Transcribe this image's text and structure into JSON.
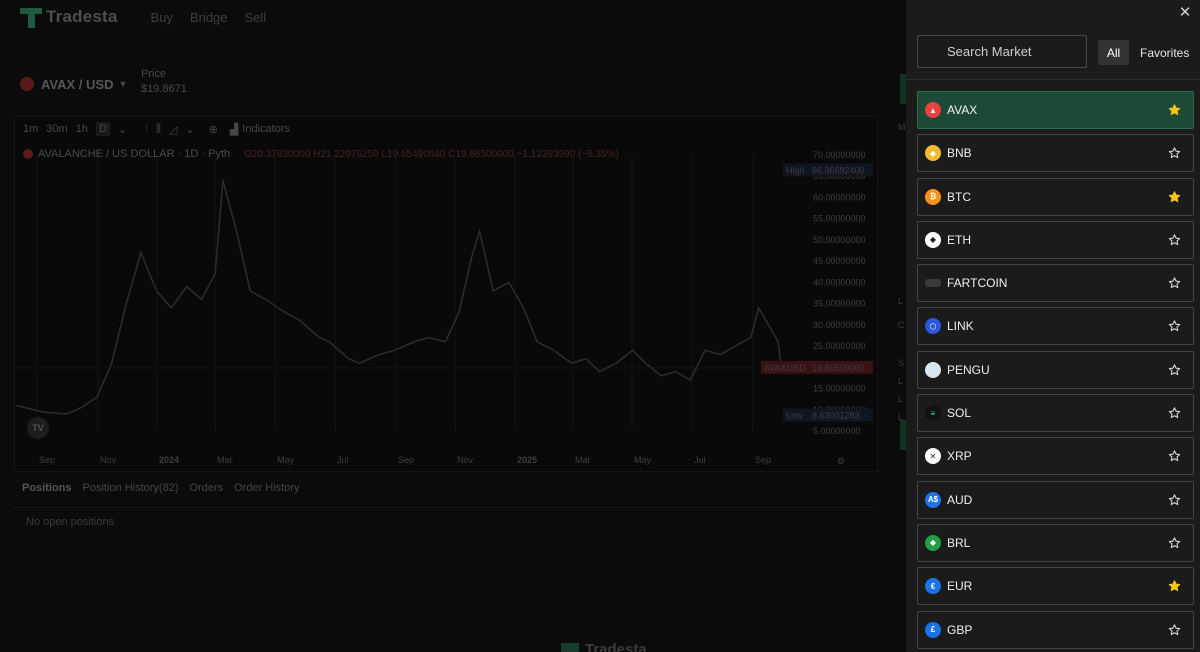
{
  "brand": {
    "name": "Tradesta"
  },
  "nav": {
    "items": [
      "Buy",
      "Bridge",
      "Sell"
    ]
  },
  "pair": {
    "label": "AVAX / USD",
    "price_label": "Price",
    "price_value": "$19.8671"
  },
  "toolbar": {
    "timeframes": [
      "1m",
      "30m",
      "1h"
    ],
    "selected_timeframe": "D",
    "indicators_label": "Indicators"
  },
  "chart": {
    "legend_title": "AVALANCHE / US DOLLAR · 1D · Pyth",
    "legend_ohlc": "O20.37630000 H21.22976250 L19.65490640 C19.86500000 −1.12393990 (−5.35%)",
    "high_label": "High",
    "high_value": "66.36692400",
    "low_label": "Low",
    "low_value": "8.63001283",
    "current_symbol": "AVAXUSD",
    "current_value": "19.86500000",
    "tv_badge": "TV"
  },
  "chart_data": {
    "type": "line",
    "title": "AVALANCHE / US DOLLAR · 1D · Pyth",
    "xlabel": "",
    "ylabel": "",
    "x_ticks": [
      "Sep",
      "Nov",
      "2024",
      "Mar",
      "May",
      "Jul",
      "Sep",
      "Nov",
      "2025",
      "Mar",
      "May",
      "Jul",
      "Sep"
    ],
    "y_ticks": [
      5,
      10,
      15,
      20,
      25,
      30,
      35,
      40,
      45,
      50,
      55,
      60,
      65,
      70
    ],
    "y_tick_labels": [
      "5.00000000",
      "10.00000000",
      "15.00000000",
      "20.00000000",
      "25.00000000",
      "30.00000000",
      "35.00000000",
      "40.00000000",
      "45.00000000",
      "50.00000000",
      "55.00000000",
      "60.00000000",
      "65.00000000",
      "70.00000000"
    ],
    "ylim": [
      5,
      70
    ],
    "grid": true,
    "series": [
      {
        "x": [
          "2023-08-20",
          "2023-09-15",
          "2023-10-10",
          "2023-10-25",
          "2023-11-10",
          "2023-11-25",
          "2023-12-10",
          "2023-12-25",
          "2024-01-10",
          "2024-01-25",
          "2024-02-10",
          "2024-02-25",
          "2024-03-10",
          "2024-03-18",
          "2024-04-01",
          "2024-04-15",
          "2024-05-01",
          "2024-05-20",
          "2024-06-05",
          "2024-06-25",
          "2024-07-05",
          "2024-07-25",
          "2024-08-05",
          "2024-08-25",
          "2024-09-10",
          "2024-09-30",
          "2024-10-15",
          "2024-11-01",
          "2024-11-15",
          "2024-11-28",
          "2024-12-06",
          "2024-12-20",
          "2025-01-05",
          "2025-01-20",
          "2025-02-03",
          "2025-02-20",
          "2025-03-10",
          "2025-03-25",
          "2025-04-08",
          "2025-04-25",
          "2025-05-12",
          "2025-05-25",
          "2025-06-10",
          "2025-06-25",
          "2025-07-10",
          "2025-07-25",
          "2025-08-10",
          "2025-08-25",
          "2025-09-10",
          "2025-09-18",
          "2025-09-28",
          "2025-10-08",
          "2025-10-11",
          "2025-10-15"
        ],
        "values": [
          11,
          9.5,
          9,
          10.5,
          13,
          21,
          35,
          47,
          38,
          34,
          39,
          36,
          42,
          64,
          52,
          38,
          36,
          33,
          31,
          27,
          26,
          22,
          21,
          23,
          24,
          26,
          27,
          26,
          33,
          46,
          52,
          38,
          40,
          34,
          26,
          24,
          21,
          22,
          19,
          21,
          24,
          21,
          18,
          19,
          17,
          24,
          23,
          25,
          27,
          34,
          30,
          26,
          20,
          19.9
        ]
      }
    ]
  },
  "positions": {
    "tabs": [
      "Positions",
      "Position History(82)",
      "Orders",
      "Order History"
    ],
    "empty_message": "No open positions"
  },
  "side_strip": {
    "letters": [
      "M",
      "L",
      "C",
      "S",
      "L",
      "L",
      "L"
    ]
  },
  "drawer": {
    "search_placeholder": "Search Market",
    "filter_all": "All",
    "filter_favorites": "Favorites",
    "markets": [
      {
        "symbol": "AVAX",
        "icon": "avax-icon",
        "color": "#e84142",
        "glyph": "▲",
        "favorite": true,
        "selected": true
      },
      {
        "symbol": "BNB",
        "icon": "bnb-icon",
        "color": "#f3ba2f",
        "glyph": "◆",
        "favorite": false,
        "selected": false
      },
      {
        "symbol": "BTC",
        "icon": "btc-icon",
        "color": "#f7931a",
        "glyph": "₿",
        "favorite": true,
        "selected": false
      },
      {
        "symbol": "ETH",
        "icon": "eth-icon",
        "color": "#ffffff",
        "glyph": "◆",
        "favorite": false,
        "selected": false
      },
      {
        "symbol": "FARTCOIN",
        "icon": "fartcoin-icon",
        "color": "#3a3a3a",
        "glyph": "",
        "favorite": false,
        "selected": false
      },
      {
        "symbol": "LINK",
        "icon": "link-icon",
        "color": "#2a5ada",
        "glyph": "⬡",
        "favorite": false,
        "selected": false
      },
      {
        "symbol": "PENGU",
        "icon": "pengu-icon",
        "color": "#d6e6f2",
        "glyph": "",
        "favorite": false,
        "selected": false
      },
      {
        "symbol": "SOL",
        "icon": "sol-icon",
        "color": "#111111",
        "glyph": "≡",
        "favorite": false,
        "selected": false
      },
      {
        "symbol": "XRP",
        "icon": "xrp-icon",
        "color": "#ffffff",
        "glyph": "✕",
        "favorite": false,
        "selected": false
      },
      {
        "symbol": "AUD",
        "icon": "aud-icon",
        "color": "#1a73e8",
        "glyph": "A$",
        "favorite": false,
        "selected": false
      },
      {
        "symbol": "BRL",
        "icon": "brl-icon",
        "color": "#229e45",
        "glyph": "◆",
        "favorite": false,
        "selected": false
      },
      {
        "symbol": "EUR",
        "icon": "eur-icon",
        "color": "#1a73e8",
        "glyph": "€",
        "favorite": true,
        "selected": false
      },
      {
        "symbol": "GBP",
        "icon": "gbp-icon",
        "color": "#1a73e8",
        "glyph": "£",
        "favorite": false,
        "selected": false
      }
    ],
    "colors": {
      "favorite_star": "#f5c518",
      "selected_bg": "#1c4a37",
      "accent": "#2b6b4f"
    }
  }
}
